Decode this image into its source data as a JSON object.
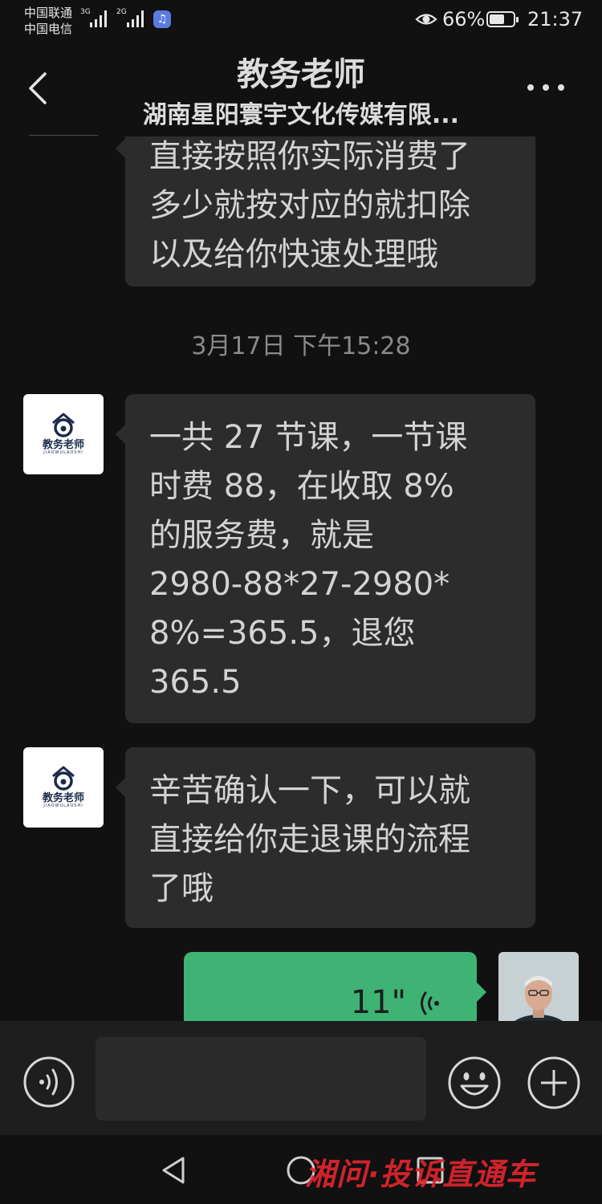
{
  "status_bar": {
    "carrier_1": "中国联通",
    "carrier_2": "中国电信",
    "network_1": "3G",
    "network_2": "2G",
    "battery": "66%",
    "time": "21:37",
    "battery_level": 0.66
  },
  "header": {
    "title": "教务老师",
    "subtitle": "湖南星阳寰宇文化传媒有限..."
  },
  "messages": {
    "partial": {
      "lines": [
        "直接按照你实际消费了",
        "多少就按对应的就扣除",
        "以及给你快速处理哦"
      ]
    },
    "timestamp": "3月17日 下午15:28",
    "msg_fee": {
      "lines": [
        "一共 27 节课，一节课",
        "时费 88，在收取 8%",
        "的服务费，就是",
        "2980-88*27-2980*",
        "8%=365.5，退您",
        "365.5"
      ]
    },
    "msg_confirm": {
      "lines": [
        "辛苦确认一下，可以就",
        "直接给你走退课的流程",
        "了哦"
      ]
    },
    "voice": {
      "duration": "11\""
    }
  },
  "avatar_logo": {
    "name": "教务老师",
    "pinyin": "JIAOWULAOSHI"
  },
  "watermark": "湘问·投诉直通车",
  "colors": {
    "background": "#111111",
    "bubble_incoming": "#2c2c2c",
    "bubble_outgoing": "#3fb374",
    "watermark": "#e0252e"
  }
}
